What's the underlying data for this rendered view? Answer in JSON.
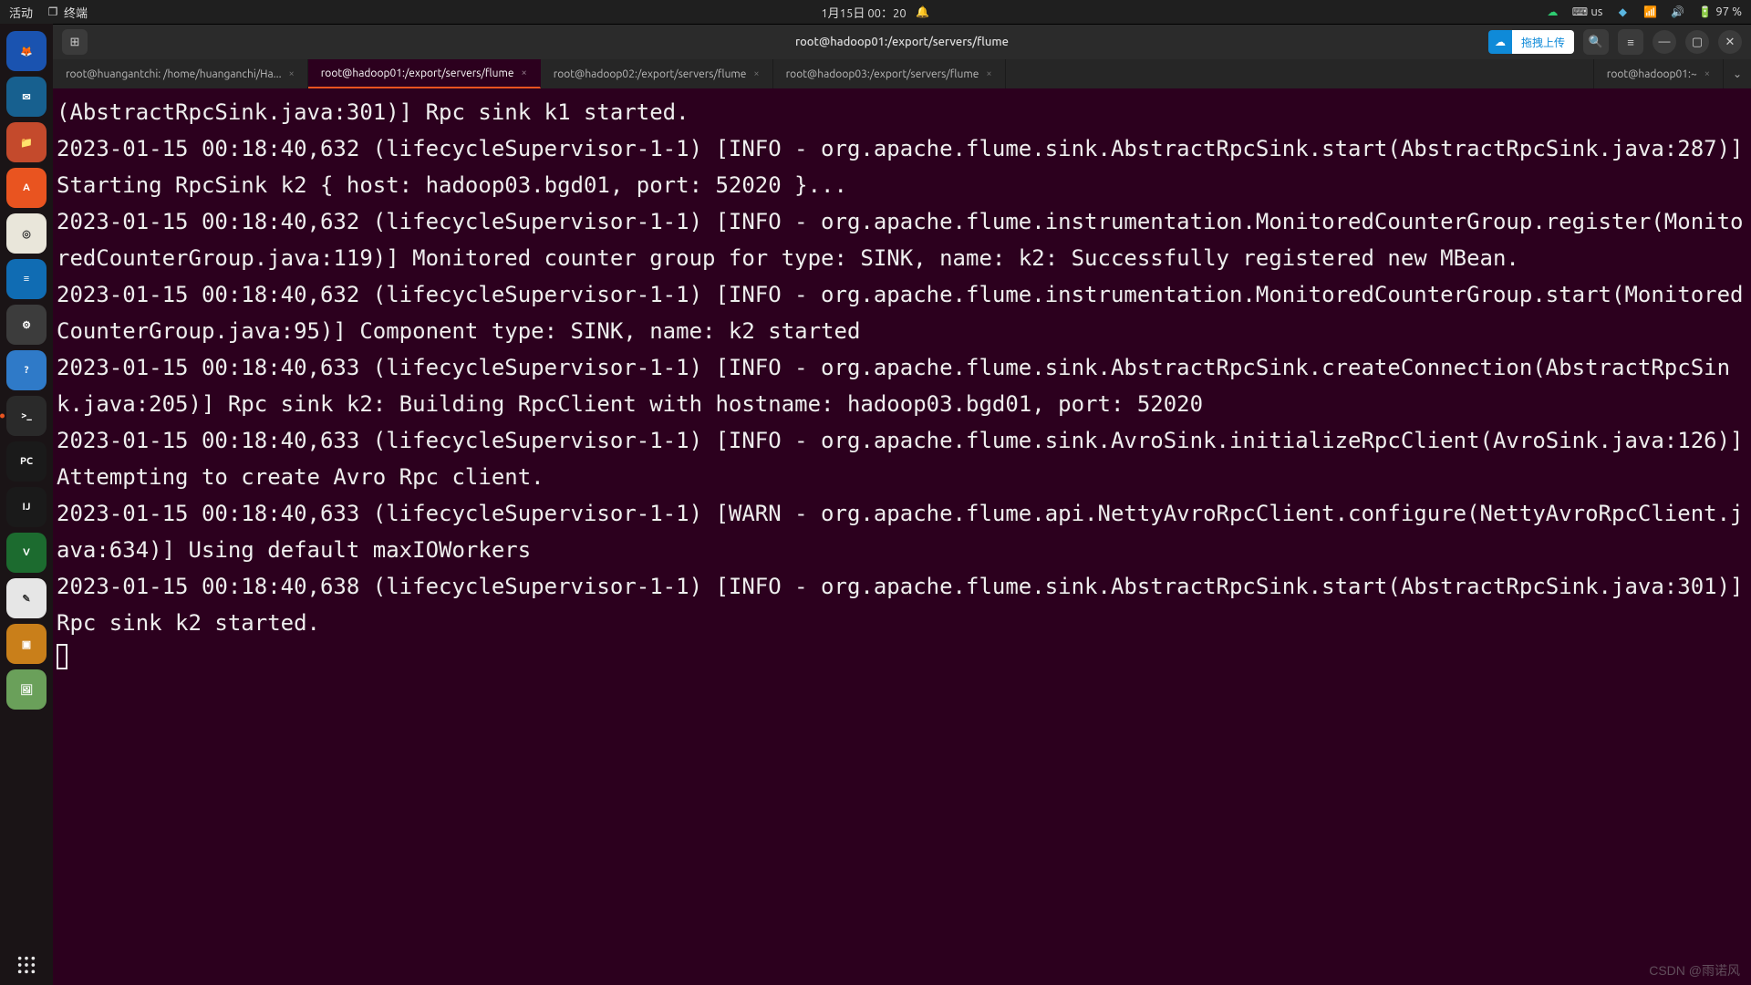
{
  "panel": {
    "activities": "活动",
    "app_label": "终端",
    "clock": "1月15日 00：20",
    "input_method": "us",
    "battery": "97 %"
  },
  "window": {
    "title": "root@hadoop01:/export/servers/flume",
    "upload_label": "拖拽上传"
  },
  "tabs": [
    {
      "label": "root@huangantchi: /home/huanganchi/Ha...",
      "active": false
    },
    {
      "label": "root@hadoop01:/export/servers/flume",
      "active": true
    },
    {
      "label": "root@hadoop02:/export/servers/flume",
      "active": false
    },
    {
      "label": "root@hadoop03:/export/servers/flume",
      "active": false
    },
    {
      "label": "root@hadoop01:~",
      "active": false,
      "last": true
    }
  ],
  "dock": [
    {
      "name": "firefox",
      "bg": "#1a53b0",
      "icon": "🦊"
    },
    {
      "name": "thunderbird",
      "bg": "#17608f",
      "icon": "✉"
    },
    {
      "name": "files",
      "bg": "#c44a2c",
      "icon": "📁"
    },
    {
      "name": "software",
      "bg": "#e95420",
      "icon": "A"
    },
    {
      "name": "rhythmbox",
      "bg": "#e9e6da",
      "icon": "◎"
    },
    {
      "name": "writer",
      "bg": "#106cb3",
      "icon": "≡"
    },
    {
      "name": "settings",
      "bg": "#3c3c3c",
      "icon": "⚙"
    },
    {
      "name": "help",
      "bg": "#2f7ac8",
      "icon": "?"
    },
    {
      "name": "terminal",
      "bg": "#2a2a2a",
      "icon": ">_",
      "active": true
    },
    {
      "name": "pycharm",
      "bg": "#1a1a1a",
      "icon": "PC"
    },
    {
      "name": "intellij",
      "bg": "#1a1a1a",
      "icon": "IJ"
    },
    {
      "name": "vim",
      "bg": "#1c6b2f",
      "icon": "V"
    },
    {
      "name": "gedit",
      "bg": "#e6e6e6",
      "icon": "✎"
    },
    {
      "name": "virtualbox",
      "bg": "#c97f1a",
      "icon": "▣"
    },
    {
      "name": "image",
      "bg": "#6aa05a",
      "icon": "🖼"
    }
  ],
  "terminal_text": "(AbstractRpcSink.java:301)] Rpc sink k1 started.\n2023-01-15 00:18:40,632 (lifecycleSupervisor-1-1) [INFO - org.apache.flume.sink.AbstractRpcSink.start(AbstractRpcSink.java:287)] Starting RpcSink k2 { host: hadoop03.bgd01, port: 52020 }...\n2023-01-15 00:18:40,632 (lifecycleSupervisor-1-1) [INFO - org.apache.flume.instrumentation.MonitoredCounterGroup.register(MonitoredCounterGroup.java:119)] Monitored counter group for type: SINK, name: k2: Successfully registered new MBean.\n2023-01-15 00:18:40,632 (lifecycleSupervisor-1-1) [INFO - org.apache.flume.instrumentation.MonitoredCounterGroup.start(MonitoredCounterGroup.java:95)] Component type: SINK, name: k2 started\n2023-01-15 00:18:40,633 (lifecycleSupervisor-1-1) [INFO - org.apache.flume.sink.AbstractRpcSink.createConnection(AbstractRpcSink.java:205)] Rpc sink k2: Building RpcClient with hostname: hadoop03.bgd01, port: 52020\n2023-01-15 00:18:40,633 (lifecycleSupervisor-1-1) [INFO - org.apache.flume.sink.AvroSink.initializeRpcClient(AvroSink.java:126)] Attempting to create Avro Rpc client.\n2023-01-15 00:18:40,633 (lifecycleSupervisor-1-1) [WARN - org.apache.flume.api.NettyAvroRpcClient.configure(NettyAvroRpcClient.java:634)] Using default maxIOWorkers\n2023-01-15 00:18:40,638 (lifecycleSupervisor-1-1) [INFO - org.apache.flume.sink.AbstractRpcSink.start(AbstractRpcSink.java:301)] Rpc sink k2 started.\n",
  "watermark": "CSDN @雨诺风"
}
